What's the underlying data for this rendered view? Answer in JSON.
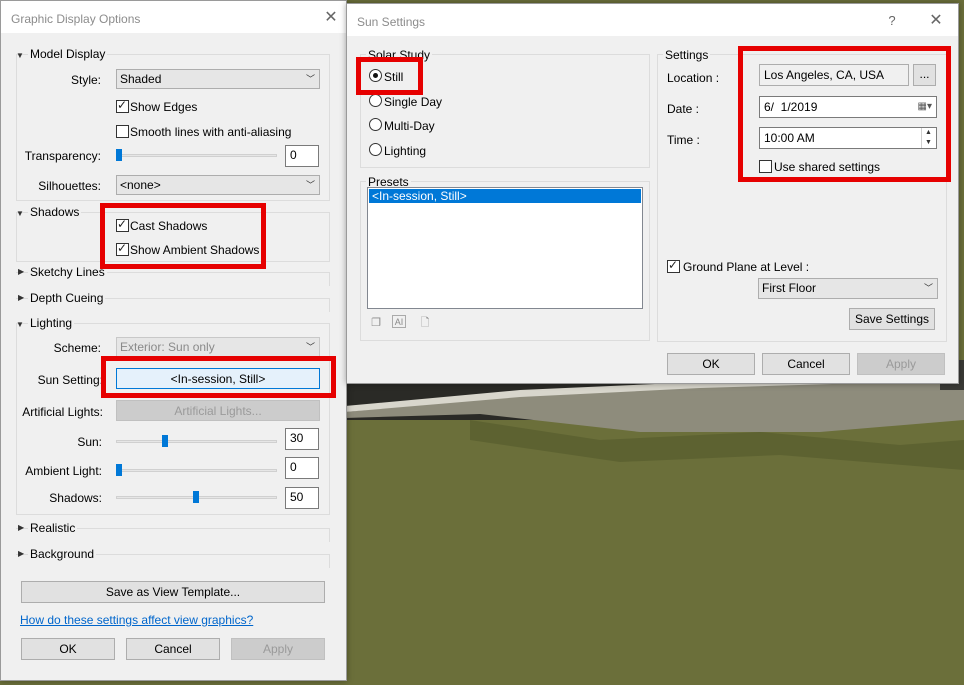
{
  "gdo": {
    "title": "Graphic Display Options",
    "model_display": {
      "heading": "Model Display",
      "style_label": "Style:",
      "style_value": "Shaded",
      "show_edges": "Show Edges",
      "smooth_lines": "Smooth lines with anti-aliasing",
      "transparency_label": "Transparency:",
      "transparency_value": "0",
      "silhouettes_label": "Silhouettes:",
      "silhouettes_value": "<none>"
    },
    "shadows": {
      "heading": "Shadows",
      "cast": "Cast Shadows",
      "ambient": "Show Ambient Shadows"
    },
    "sketchy_lines": "Sketchy Lines",
    "depth_cueing": "Depth Cueing",
    "lighting": {
      "heading": "Lighting",
      "scheme_label": "Scheme:",
      "scheme_value": "Exterior: Sun only",
      "sun_setting_label": "Sun Setting:",
      "sun_setting_value": "<In-session, Still>",
      "artificial_label": "Artificial Lights:",
      "artificial_button": "Artificial Lights...",
      "sun_label": "Sun:",
      "sun_value": "30",
      "ambient_label": "Ambient Light:",
      "ambient_value": "0",
      "shadows_label": "Shadows:",
      "shadows_value": "50"
    },
    "realistic": "Realistic",
    "background": "Background",
    "save_template": "Save as View Template...",
    "help_link": "How do these settings affect view graphics?",
    "ok": "OK",
    "cancel": "Cancel",
    "apply": "Apply"
  },
  "sun": {
    "title": "Sun Settings",
    "help": "?",
    "solar_study": {
      "heading": "Solar Study",
      "still": "Still",
      "single_day": "Single Day",
      "multi_day": "Multi-Day",
      "lighting": "Lighting"
    },
    "presets": {
      "heading": "Presets",
      "items": [
        "<In-session, Still>"
      ]
    },
    "settings": {
      "heading": "Settings",
      "location_label": "Location :",
      "location_value": "Los Angeles, CA, USA",
      "location_browse": "...",
      "date_label": "Date :",
      "date_value": "6/  1/2019",
      "time_label": "Time :",
      "time_value": "10:00 AM",
      "use_shared": "Use shared settings",
      "ground_plane": "Ground Plane at Level :",
      "level_value": "First Floor",
      "save_settings": "Save Settings"
    },
    "ok": "OK",
    "cancel": "Cancel",
    "apply": "Apply"
  },
  "colors": {
    "highlight": "#e60000",
    "accent": "#0078d7",
    "terrain": "#6b6f3a"
  }
}
